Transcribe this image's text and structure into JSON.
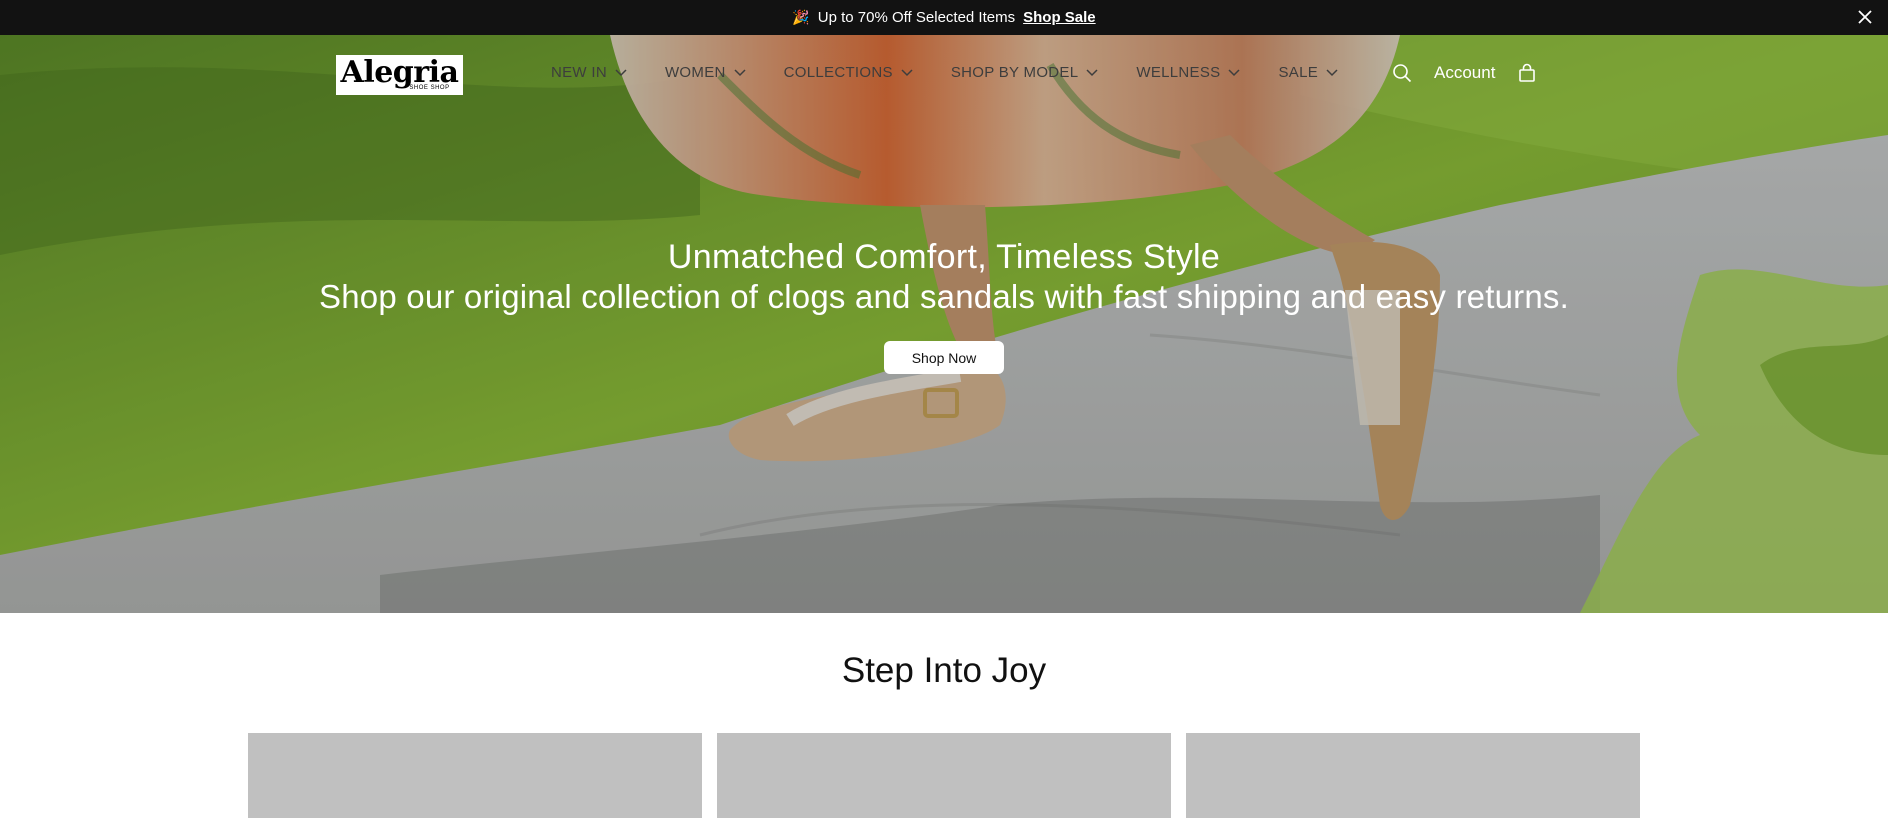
{
  "announcement": {
    "emoji": "🎉",
    "text": "Up to 70% Off Selected Items",
    "link_label": "Shop Sale",
    "close_icon": "close-icon"
  },
  "header": {
    "logo_text": "Alegria",
    "logo_sub": "SHOE SHOP",
    "nav_items": [
      "NEW IN",
      "WOMEN",
      "COLLECTIONS",
      "SHOP BY MODEL",
      "WELLNESS",
      "SALE"
    ],
    "search_icon": "search-icon",
    "account_label": "Account",
    "cart_icon": "shopping-bag-icon"
  },
  "hero": {
    "title": "Unmatched Comfort, Timeless Style",
    "subtitle": "Shop our original collection of clogs and sandals with fast shipping and easy returns.",
    "cta_label": "Shop Now"
  },
  "section": {
    "title": "Step Into Joy",
    "card_count_visible": 3
  },
  "colors": {
    "announcement_bg": "#121212",
    "card_placeholder": "#c0c0c0",
    "button_bg": "#ffffff"
  }
}
